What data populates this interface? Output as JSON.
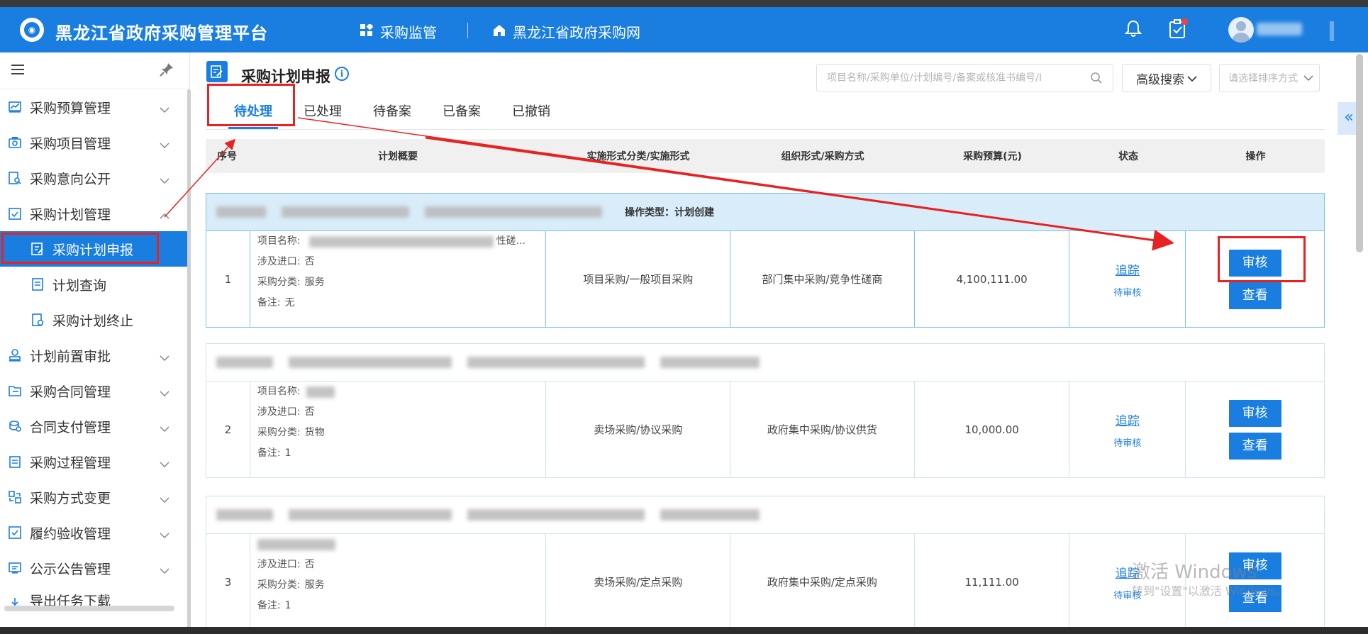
{
  "header": {
    "app_title": "黑龙江省政府采购管理平台",
    "nav_supervision": "采购监管",
    "nav_website": "黑龙江省政府采购网"
  },
  "sidebar": {
    "items": [
      {
        "label": "采购预算管理"
      },
      {
        "label": "采购项目管理"
      },
      {
        "label": "采购意向公开"
      },
      {
        "label": "采购计划管理"
      },
      {
        "label": "采购计划申报"
      },
      {
        "label": "计划查询"
      },
      {
        "label": "采购计划终止"
      },
      {
        "label": "计划前置审批"
      },
      {
        "label": "采购合同管理"
      },
      {
        "label": "合同支付管理"
      },
      {
        "label": "采购过程管理"
      },
      {
        "label": "采购方式变更"
      },
      {
        "label": "履约验收管理"
      },
      {
        "label": "公示公告管理"
      },
      {
        "label": "导出任务下载"
      }
    ]
  },
  "page": {
    "title": "采购计划申报",
    "search_placeholder": "项目名称/采购单位/计划编号/备案或核准书编号/I",
    "advanced_search": "高级搜索",
    "sort_placeholder": "请选择排序方式"
  },
  "tabs": [
    "待处理",
    "已处理",
    "待备案",
    "已备案",
    "已撤销"
  ],
  "table": {
    "headers": [
      "序号",
      "计划概要",
      "实施形式分类/实施形式",
      "组织形式/采购方式",
      "采购预算(元)",
      "状态",
      "操作"
    ],
    "op_type_label": "操作类型：计划创建",
    "rows": [
      {
        "no": "1",
        "name_label": "项目名称:",
        "name_tail": "性磋...",
        "import_label": "涉及进口:",
        "import_value": "否",
        "category_label": "采购分类:",
        "category_value": "服务",
        "remark_label": "备注:",
        "remark_value": "无",
        "form": "项目采购/一般项目采购",
        "org": "部门集中采购/竞争性磋商",
        "budget": "4,100,111.00",
        "track": "追踪",
        "status": "待审核",
        "btn_review": "审核",
        "btn_view": "查看"
      },
      {
        "no": "2",
        "name_label": "项目名称:",
        "name_tail": "",
        "import_label": "涉及进口:",
        "import_value": "否",
        "category_label": "采购分类:",
        "category_value": "货物",
        "remark_label": "备注:",
        "remark_value": "1",
        "form": "卖场采购/协议采购",
        "org": "政府集中采购/协议供货",
        "budget": "10,000.00",
        "track": "追踪",
        "status": "待审核",
        "btn_review": "审核",
        "btn_view": "查看"
      },
      {
        "no": "3",
        "name_label": "",
        "name_tail": "",
        "import_label": "涉及进口:",
        "import_value": "否",
        "category_label": "采购分类:",
        "category_value": "服务",
        "remark_label": "备注:",
        "remark_value": "1",
        "form": "卖场采购/定点采购",
        "org": "政府集中采购/定点采购",
        "budget": "11,111.00",
        "track": "追踪",
        "status": "待审核",
        "btn_review": "审核",
        "btn_view": "查看"
      }
    ]
  },
  "watermark": {
    "line1": "激活 Windows",
    "line2": "转到\"设置\"以激活 Windows。"
  },
  "colors": {
    "primary": "#1a7ee0",
    "annotation": "#e62222"
  }
}
